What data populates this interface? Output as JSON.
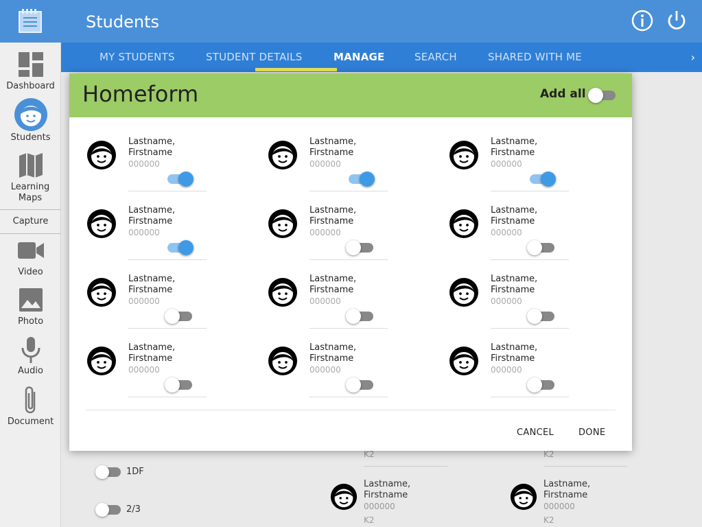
{
  "header": {
    "title": "Students"
  },
  "tabs": [
    {
      "label": "MY STUDENTS"
    },
    {
      "label": "STUDENT DETAILS"
    },
    {
      "label": "MANAGE"
    },
    {
      "label": "SEARCH"
    },
    {
      "label": "SHARED WITH ME"
    }
  ],
  "sidebar": {
    "items": [
      {
        "label": "Dashboard"
      },
      {
        "label": "Students"
      },
      {
        "label": "Learning Maps"
      },
      {
        "label": "Video"
      },
      {
        "label": "Photo"
      },
      {
        "label": "Audio"
      },
      {
        "label": "Document"
      }
    ],
    "capture_label": "Capture"
  },
  "modal": {
    "title": "Homeform",
    "add_all_label": "Add all",
    "add_all_on": false,
    "students": [
      {
        "name1": "Lastname,",
        "name2": "Firstname",
        "id": "000000",
        "on": true
      },
      {
        "name1": "Lastname,",
        "name2": "Firstname",
        "id": "000000",
        "on": true
      },
      {
        "name1": "Lastname,",
        "name2": "Firstname",
        "id": "000000",
        "on": true
      },
      {
        "name1": "Lastname,",
        "name2": "Firstname",
        "id": "000000",
        "on": true
      },
      {
        "name1": "Lastname,",
        "name2": "Firstname",
        "id": "000000",
        "on": false
      },
      {
        "name1": "Lastname,",
        "name2": "Firstname",
        "id": "000000",
        "on": false
      },
      {
        "name1": "Lastname,",
        "name2": "Firstname",
        "id": "000000",
        "on": false
      },
      {
        "name1": "Lastname,",
        "name2": "Firstname",
        "id": "000000",
        "on": false
      },
      {
        "name1": "Lastname,",
        "name2": "Firstname",
        "id": "000000",
        "on": false
      },
      {
        "name1": "Lastname,",
        "name2": "Firstname",
        "id": "000000",
        "on": false
      },
      {
        "name1": "Lastname,",
        "name2": "Firstname",
        "id": "000000",
        "on": false
      },
      {
        "name1": "Lastname,",
        "name2": "Firstname",
        "id": "000000",
        "on": false
      }
    ],
    "cancel_label": "CANCEL",
    "done_label": "DONE"
  },
  "background": {
    "groups": [
      {
        "label": "1DF"
      },
      {
        "label": "2/3"
      }
    ],
    "cards": [
      {
        "name1": "Lastname,",
        "name2": "Firstname",
        "id": "000000",
        "grade": "K2"
      },
      {
        "name1": "Lastname,",
        "name2": "Firstname",
        "id": "000000",
        "grade": "K2"
      }
    ],
    "partial_grades": [
      "K2",
      "K2"
    ]
  },
  "colors": {
    "header": "#4a90d9",
    "tabs": "#2f7fd6",
    "modal_header": "#9ccc65",
    "toggle_on": "#3f9ae6",
    "tab_indicator": "#e8e65a"
  }
}
